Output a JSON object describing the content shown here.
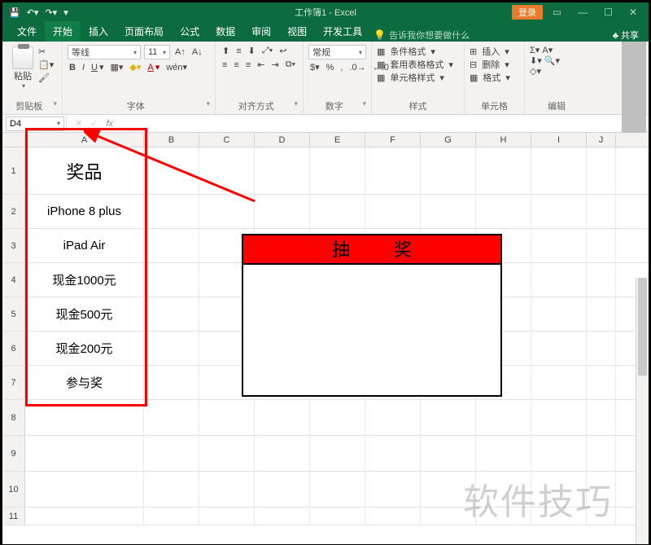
{
  "titlebar": {
    "title": "工作簿1 - Excel",
    "login": "登录"
  },
  "tabs": {
    "file": "文件",
    "home": "开始",
    "insert": "插入",
    "layout": "页面布局",
    "formulas": "公式",
    "data": "数据",
    "review": "审阅",
    "view": "视图",
    "dev": "开发工具",
    "tellme": "告诉我你想要做什么",
    "share": "共享"
  },
  "ribbon": {
    "paste": "粘贴",
    "clipboard": "剪贴板",
    "font_name": "等线",
    "font_size": "11",
    "font": "字体",
    "alignment": "对齐方式",
    "wrap": "自动换行",
    "merge": "合并后居中",
    "number_format": "常规",
    "number": "数字",
    "cond_fmt": "条件格式",
    "table_fmt": "套用表格格式",
    "cell_style": "单元格样式",
    "styles": "样式",
    "insert_btn": "插入",
    "delete_btn": "删除",
    "format_btn": "格式",
    "cells": "单元格",
    "editing": "编辑"
  },
  "namebox": "D4",
  "columns": [
    "A",
    "B",
    "C",
    "D",
    "E",
    "F",
    "G",
    "H",
    "I",
    "J"
  ],
  "rows": [
    "1",
    "2",
    "3",
    "4",
    "5",
    "6",
    "7",
    "8",
    "9",
    "10",
    "11"
  ],
  "colA": {
    "header": "奖品",
    "items": [
      "iPhone 8 plus",
      "iPad Air",
      "现金1000元",
      "现金500元",
      "现金200元",
      "参与奖"
    ]
  },
  "draw_box": {
    "title": "抽 奖"
  },
  "watermark": "软件技巧"
}
